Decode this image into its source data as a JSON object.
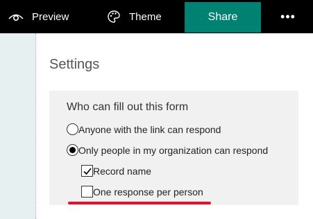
{
  "toolbar": {
    "preview_label": "Preview",
    "preview_icon": "eye-icon",
    "theme_label": "Theme",
    "theme_icon": "palette-icon",
    "share_label": "Share",
    "more_label": "•••",
    "share_color": "#008272"
  },
  "settings": {
    "title": "Settings",
    "section_heading": "Who can fill out this form",
    "options": [
      {
        "label": "Anyone with the link can respond",
        "type": "radio",
        "checked": false
      },
      {
        "label": "Only people in my organization can respond",
        "type": "radio",
        "checked": true
      }
    ],
    "sub_options": [
      {
        "label": "Record name",
        "type": "checkbox",
        "checked": true
      },
      {
        "label": "One response per person",
        "type": "checkbox",
        "checked": false
      }
    ],
    "highlight_color": "#e8112d"
  }
}
